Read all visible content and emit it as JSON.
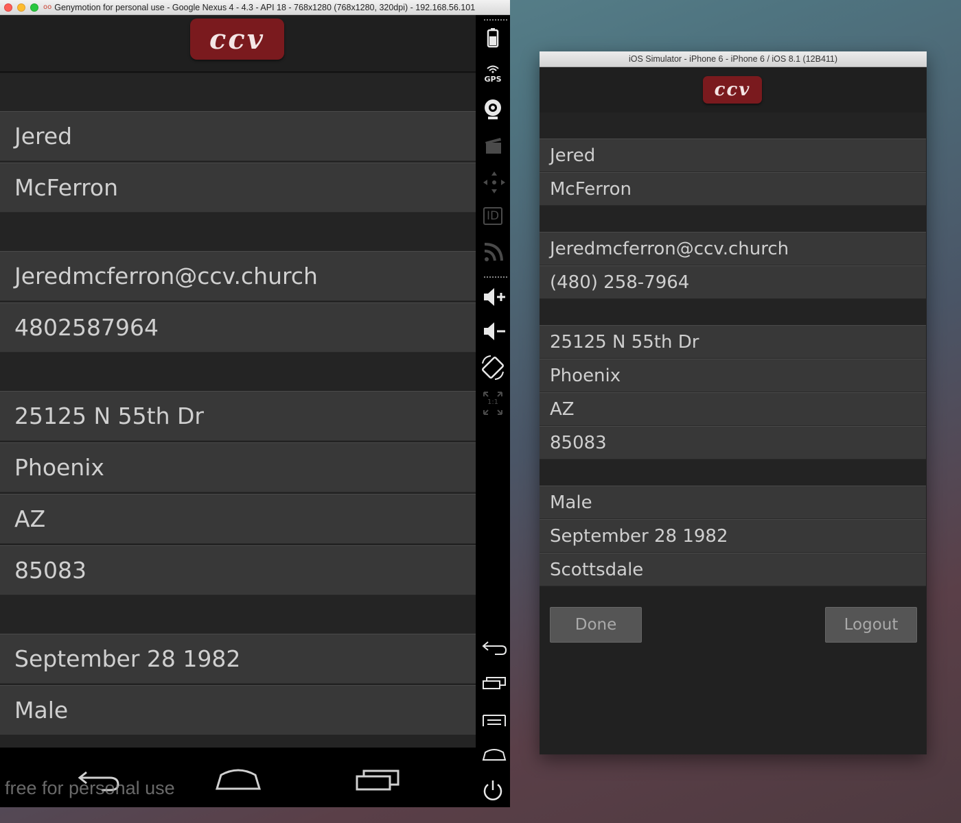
{
  "genymotion": {
    "window_title": "Genymotion for personal use - Google Nexus 4 - 4.3 - API 18 - 768x1280 (768x1280, 320dpi) - 192.168.56.101",
    "app_icon": "oo",
    "logo_text": "ccv",
    "fields": {
      "first_name": "Jered",
      "last_name": "McFerron",
      "email": "Jeredmcferron@ccv.church",
      "phone": "4802587964",
      "street": "25125 N 55th Dr",
      "city": "Phoenix",
      "state": "AZ",
      "zip": "85083",
      "birthdate": "September 28 1982",
      "gender": "Male"
    },
    "toolbar": {
      "gps_label": "GPS",
      "id_label": "ID",
      "scale_label": "1:1",
      "icons": [
        "battery-icon",
        "gps-icon",
        "webcam-icon",
        "screencast-icon",
        "move-icon",
        "id-icon",
        "network-icon",
        "volume-up-icon",
        "volume-down-icon",
        "rotate-icon",
        "scale-icon",
        "back-icon",
        "recent-apps-icon",
        "menu-icon",
        "home-icon",
        "power-icon"
      ]
    },
    "navbar": {
      "icons": [
        "back-icon",
        "home-icon",
        "recent-apps-icon"
      ]
    },
    "watermark": "free for personal use"
  },
  "ios": {
    "window_title": "iOS Simulator - iPhone 6 - iPhone 6 / iOS 8.1 (12B411)",
    "logo_text": "ccv",
    "fields": {
      "first_name": "Jered",
      "last_name": "McFerron",
      "email": "Jeredmcferron@ccv.church",
      "phone": "(480) 258-7964",
      "street": "25125 N 55th Dr",
      "city": "Phoenix",
      "state": "AZ",
      "zip": "85083",
      "gender": "Male",
      "birthdate": "September 28 1982",
      "campus": "Scottsdale"
    },
    "buttons": {
      "done": "Done",
      "logout": "Logout"
    }
  },
  "colors": {
    "logo_red": "#7a1a1e",
    "field_bg": "#383838",
    "spacer_bg": "#242424",
    "text": "#d0d0d0"
  }
}
